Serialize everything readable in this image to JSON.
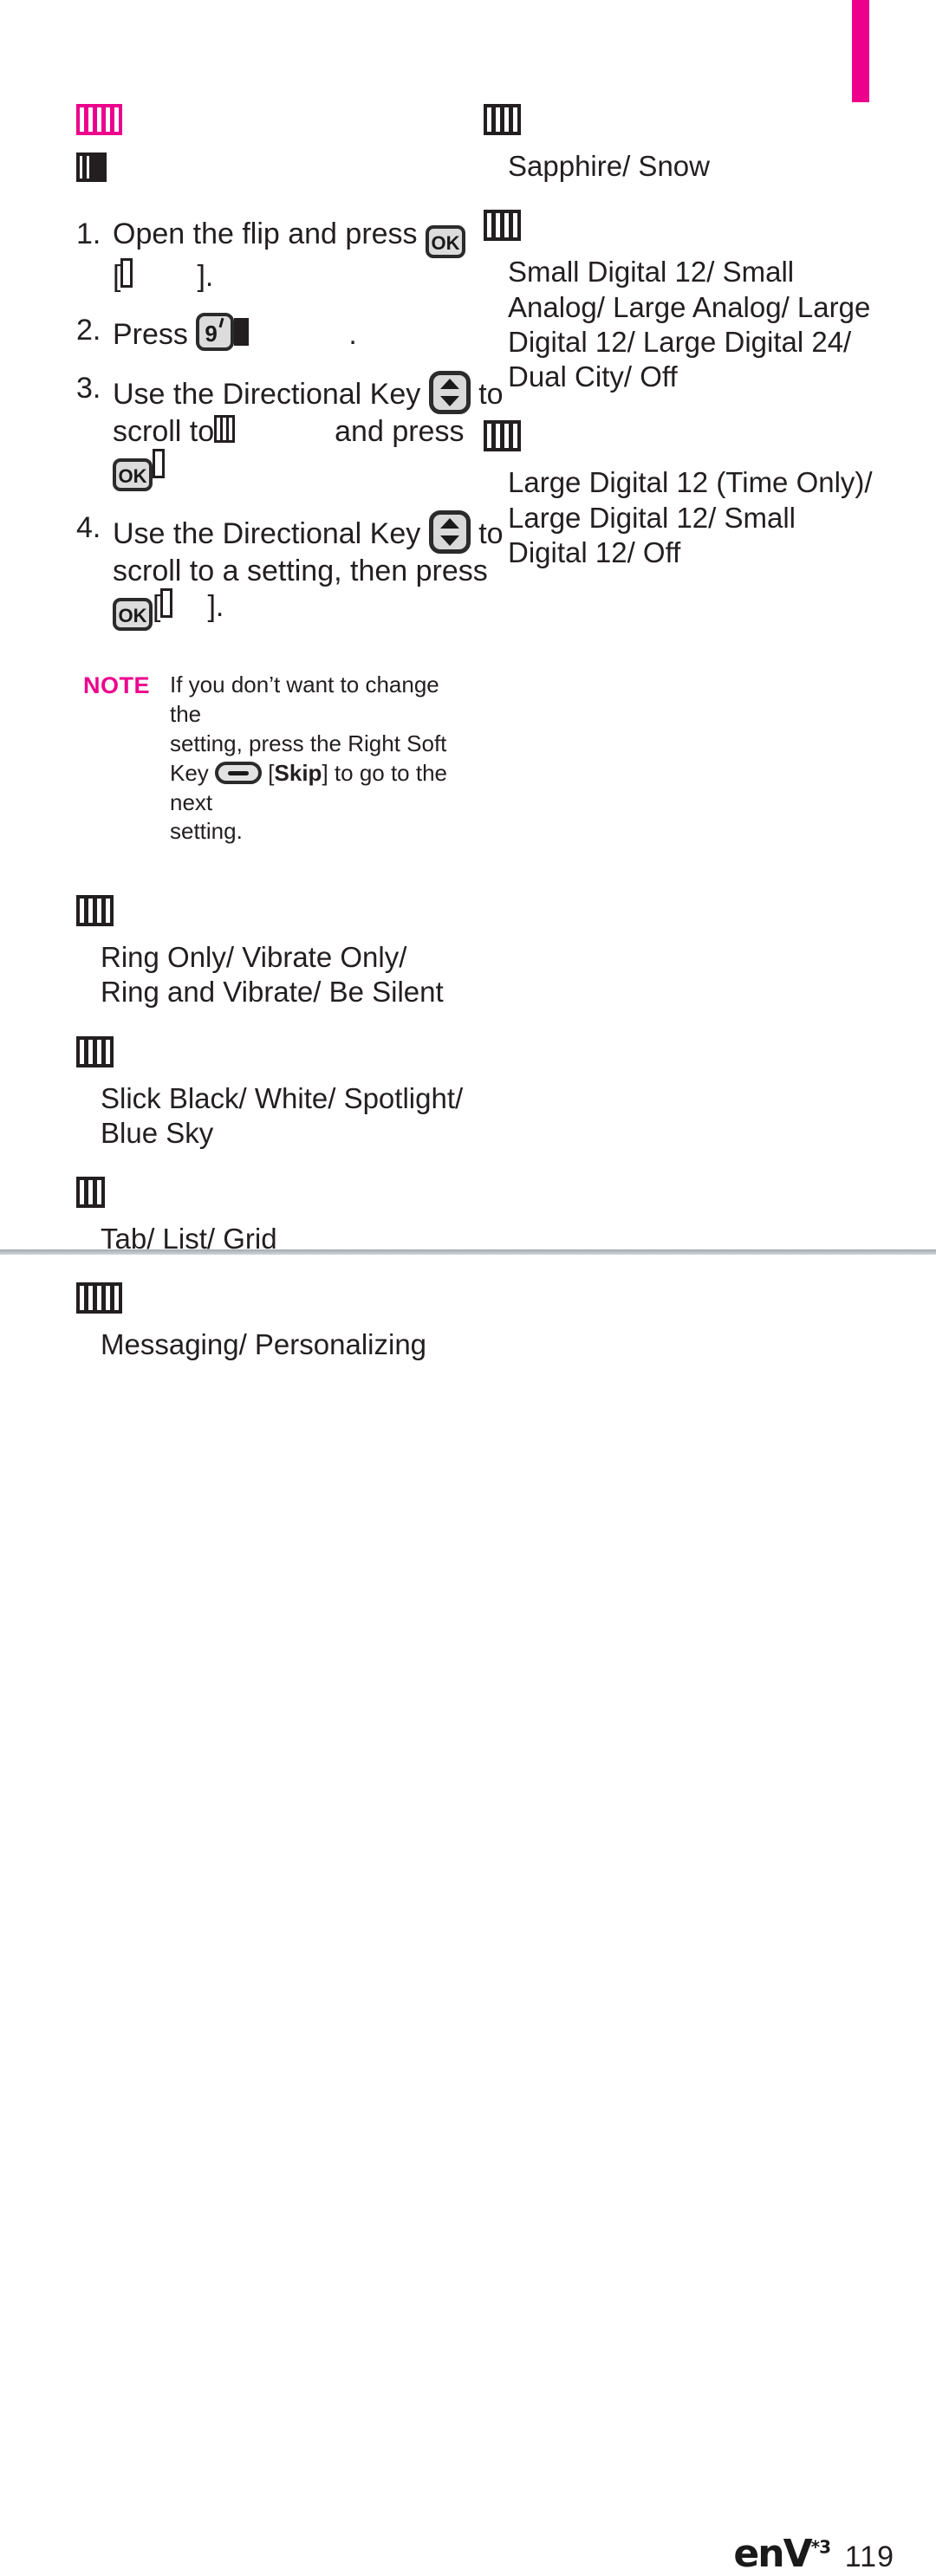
{
  "page": {
    "number": "119",
    "brand": "enV",
    "brand_superscript": "*3",
    "tab_marker_color": "#ec008c",
    "accent_color": "#ec008c",
    "text_color": "#231f20"
  },
  "left_column": {
    "title_glyphs": "missing-glyph-heading",
    "subtitle_glyphs": "missing-glyph-subheading",
    "steps": [
      {
        "number": "1.",
        "part_a": "Open the flip and press",
        "key": "OK",
        "bracket_open": "[",
        "bracket_close": "].",
        "inner_glyph": "missing-glyph"
      },
      {
        "number": "2.",
        "part_a": "Press",
        "key": "9",
        "trailing": ".",
        "inner_glyph": "missing-glyph"
      },
      {
        "number": "3.",
        "part_a": "Use the Directional Key",
        "part_b": "to",
        "part_c": "scroll to",
        "part_d": "and press",
        "key": "OK",
        "inner_glyph": "missing-glyph"
      },
      {
        "number": "4.",
        "part_a": "Use the Directional Key",
        "part_b": "to",
        "part_c": "scroll to a setting, then press",
        "key": "OK",
        "bracket_open": "[",
        "bracket_close": "].",
        "inner_glyph": "missing-glyph"
      }
    ],
    "note": {
      "label": "NOTE",
      "line1": "If you don’t want to change the",
      "line2": "setting, press the Right Soft",
      "line3_pre": "Key",
      "line3_bracket_open": "[",
      "line3_bold": "Skip",
      "line3_bracket_close": "]",
      "line3_post": "to go to the next",
      "line4": "setting."
    },
    "sections": [
      {
        "heading_glyphs": "missing-glyph",
        "values": "Ring Only/ Vibrate Only/ Ring and Vibrate/ Be Silent"
      },
      {
        "heading_glyphs": "missing-glyph",
        "values": "Slick Black/ White/ Spotlight/ Blue Sky"
      },
      {
        "heading_glyphs": "missing-glyph",
        "values": "Tab/ List/ Grid"
      },
      {
        "heading_glyphs": "missing-glyph",
        "values": "Messaging/ Personalizing"
      }
    ]
  },
  "right_column": {
    "sections": [
      {
        "heading_glyphs": "missing-glyph",
        "values": "Sapphire/ Snow"
      },
      {
        "heading_glyphs": "missing-glyph",
        "values": "Small Digital 12/ Small Analog/ Large Analog/ Large Digital 12/ Large Digital 24/ Dual City/ Off"
      },
      {
        "heading_glyphs": "missing-glyph",
        "values": "Large Digital 12 (Time Only)/ Large Digital 12/ Small Digital 12/ Off"
      }
    ]
  }
}
